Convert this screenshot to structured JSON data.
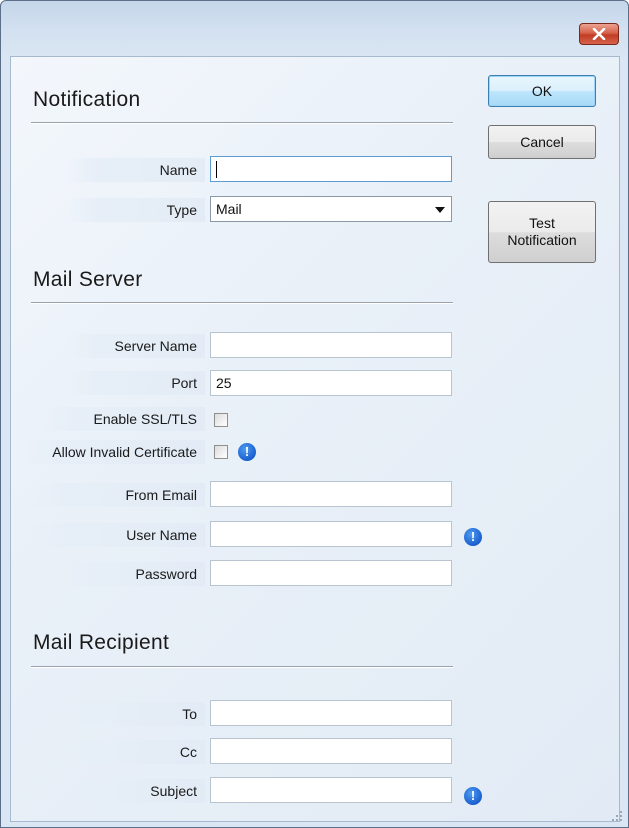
{
  "titlebar": {
    "close_icon": "close-icon"
  },
  "buttons": {
    "ok": "OK",
    "cancel": "Cancel",
    "test_line1": "Test",
    "test_line2": "Notification"
  },
  "notification": {
    "title": "Notification",
    "name_label": "Name",
    "name_value": "",
    "type_label": "Type",
    "type_value": "Mail"
  },
  "mail_server": {
    "title": "Mail Server",
    "server_name_label": "Server Name",
    "server_name_value": "",
    "port_label": "Port",
    "port_value": "25",
    "ssl_label": "Enable SSL/TLS",
    "ssl_checked": false,
    "invalid_cert_label": "Allow Invalid Certificate",
    "invalid_cert_checked": false,
    "from_email_label": "From Email",
    "from_email_value": "",
    "user_name_label": "User Name",
    "user_name_value": "",
    "password_label": "Password",
    "password_value": ""
  },
  "mail_recipient": {
    "title": "Mail Recipient",
    "to_label": "To",
    "to_value": "",
    "cc_label": "Cc",
    "cc_value": "",
    "subject_label": "Subject",
    "subject_value": ""
  },
  "info_icon_glyph": "!",
  "colors": {
    "accent": "#3c7fb1",
    "info_icon": "#1a5fcf",
    "close_button": "#c23b25"
  }
}
